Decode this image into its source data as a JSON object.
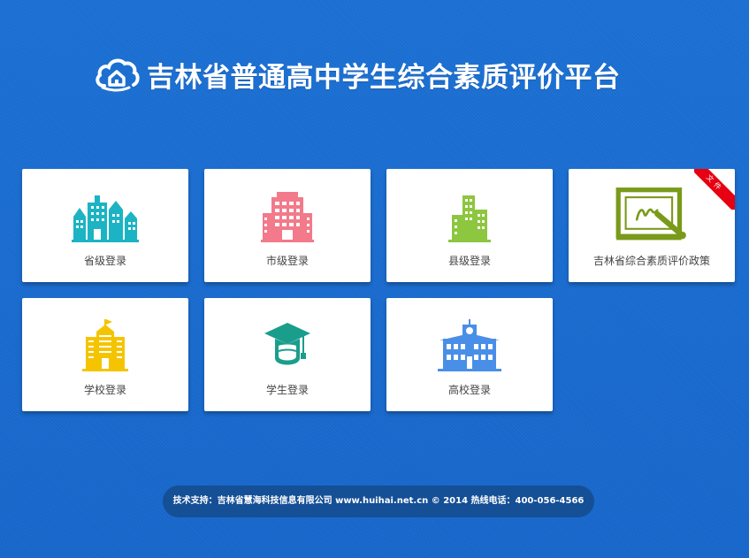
{
  "header": {
    "title": "吉林省普通高中学生综合素质评价平台",
    "logo_icon": "cloud-home-icon"
  },
  "tiles": [
    {
      "label": "省级登录",
      "icon": "city-buildings-icon",
      "color": "#1cb4c4"
    },
    {
      "label": "市级登录",
      "icon": "office-building-icon",
      "color": "#f27a8a"
    },
    {
      "label": "县级登录",
      "icon": "town-buildings-icon",
      "color": "#8dc63f"
    },
    {
      "label": "吉林省综合素质评价政策",
      "icon": "whiteboard-pen-icon",
      "color": "#7a9a1a",
      "ribbon": "文件"
    },
    {
      "label": "学校登录",
      "icon": "school-building-icon",
      "color": "#f5c400"
    },
    {
      "label": "学生登录",
      "icon": "graduate-cap-icon",
      "color": "#1a9e8c"
    },
    {
      "label": "高校登录",
      "icon": "university-building-icon",
      "color": "#4a8fe7"
    }
  ],
  "footer": {
    "text": "技术支持：吉林省慧海科技信息有限公司 www.huihai.net.cn © 2014 热线电话：400-056-4566"
  },
  "colors": {
    "background": "#1a6dd0",
    "footer_bg": "#154f96",
    "ribbon": "#e60012"
  }
}
